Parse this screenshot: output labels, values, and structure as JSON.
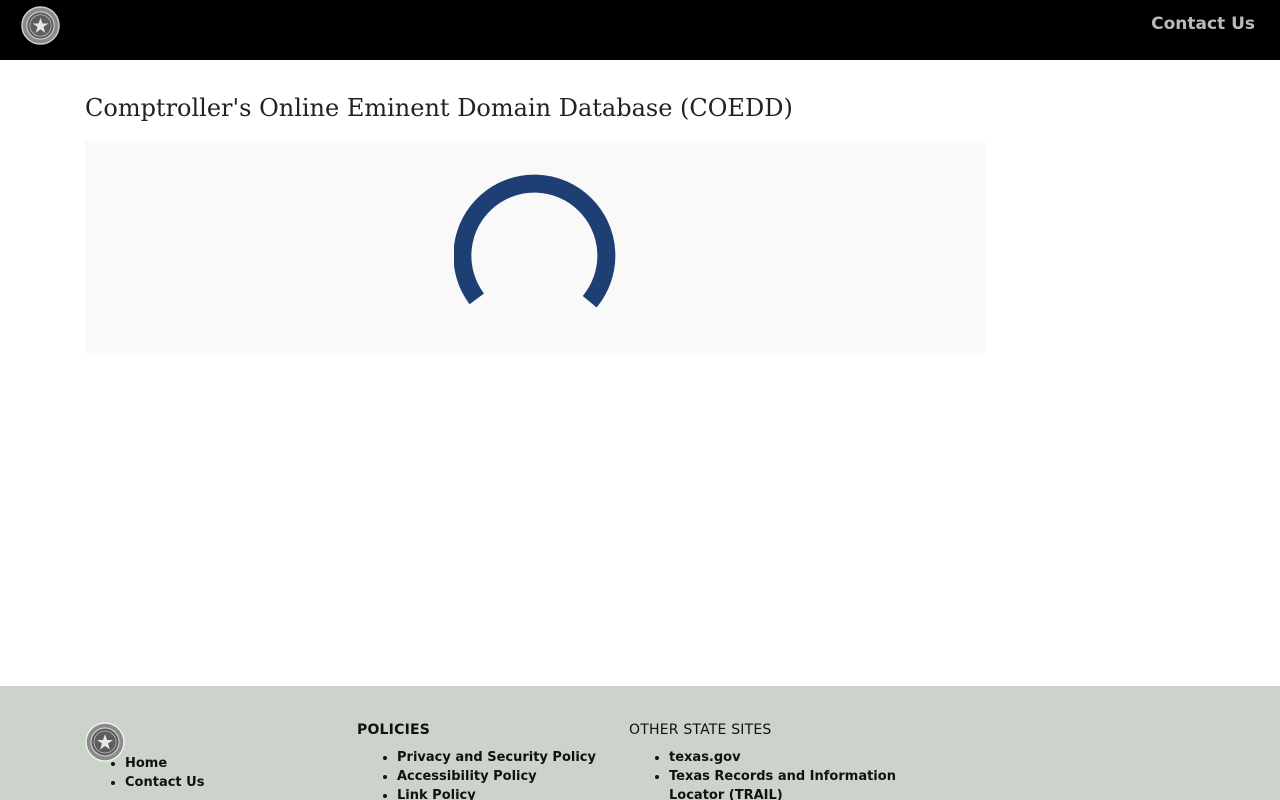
{
  "header": {
    "contact_label": "Contact Us"
  },
  "main": {
    "title": "Comptroller's Online Eminent Domain Database (COEDD)",
    "loading": {
      "spinner_color": "#1e3f73"
    }
  },
  "footer": {
    "nav": [
      "Home",
      "Contact Us"
    ],
    "policies": {
      "heading": "POLICIES",
      "items": [
        "Privacy and Security Policy",
        "Accessibility Policy",
        "Link Policy"
      ]
    },
    "other_sites": {
      "heading": "OTHER STATE SITES",
      "items": [
        "texas.gov",
        "Texas Records and Information Locator (TRAIL)"
      ]
    }
  },
  "colors": {
    "header_bg": "#000000",
    "footer_bg": "#cbd3ca",
    "accent": "#1e3f73"
  }
}
